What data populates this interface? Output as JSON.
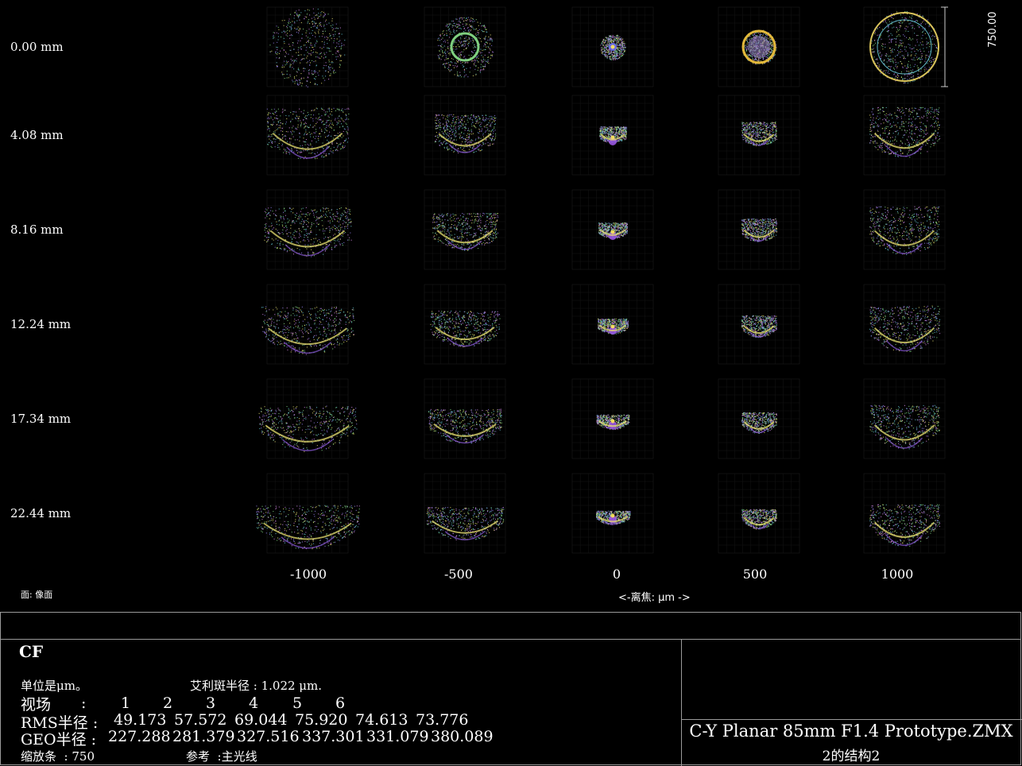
{
  "chart_data": {
    "type": "scatter",
    "kind": "through-focus spot diagram",
    "field_labels": [
      "0.00 mm",
      "4.08 mm",
      "8.16 mm",
      "12.24 mm",
      "17.34 mm",
      "22.44 mm"
    ],
    "defocus_values": [
      -1000,
      -500,
      0,
      500,
      1000
    ],
    "defocus_labels": [
      "-1000",
      "-500",
      "0",
      "500",
      "1000"
    ],
    "xlabel": "<-离焦:  μm ->",
    "scale_bar_label": "750.00",
    "surface_label": "面: 像面",
    "wavelength_colors": [
      "#d9d36a",
      "#7fd07f",
      "#5fb8c8",
      "#8c78e0",
      "#c77fd8"
    ],
    "grid": true
  },
  "panel": {
    "heading": "CF",
    "units_line": "单位是μm。",
    "airy_label": "艾利斑半径 : 1.022 μm.",
    "field_row_label": "视场",
    "field_row_colon": ":",
    "field_numbers": [
      "1",
      "2",
      "3",
      "4",
      "5",
      "6"
    ],
    "rms_label": "RMS半径 :",
    "rms_values": [
      "49.173",
      "57.572",
      "69.044",
      "75.920",
      "74.613",
      "73.776"
    ],
    "geo_label": "GEO半径 :",
    "geo_values": [
      "227.288",
      "281.379",
      "327.516",
      "337.301",
      "331.079",
      "380.089"
    ],
    "scale_line": "缩放条  : 750",
    "reference_line": "参考  :主光线",
    "file_title": "C-Y Planar 85mm F1.4 Prototype.ZMX",
    "config_line": "2的结构2"
  }
}
